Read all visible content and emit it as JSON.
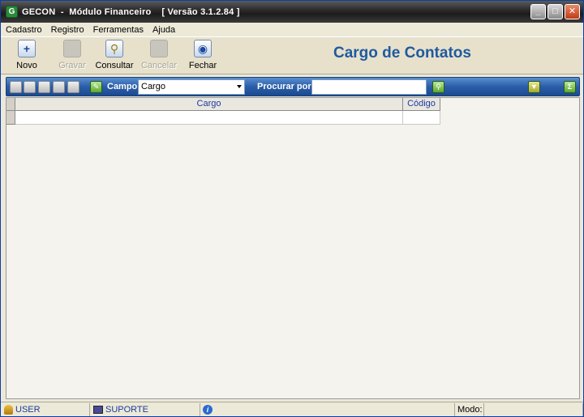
{
  "window": {
    "title": "GECON  -  Módulo Financeiro    [ Versão 3.1.2.84 ]",
    "app_icon_letter": "G"
  },
  "menu": {
    "items": [
      "Cadastro",
      "Registro",
      "Ferramentas",
      "Ajuda"
    ]
  },
  "toolbar": {
    "novo": "Novo",
    "gravar": "Gravar",
    "consultar": "Consultar",
    "cancelar": "Cancelar",
    "fechar": "Fechar"
  },
  "form": {
    "title": "Cargo de Contatos"
  },
  "search": {
    "campo_label": "Campo",
    "campo_value": "Cargo",
    "procurar_label": "Procurar por",
    "procurar_value": ""
  },
  "grid": {
    "columns": [
      "Cargo",
      "Código"
    ]
  },
  "status": {
    "user": "USER",
    "machine": "SUPORTE",
    "modo_label": "Modo:",
    "modo_value": ""
  },
  "colors": {
    "title_accent": "#1f5a9e",
    "searchbar": "#2a5ea8",
    "grid_header_text": "#1c3aa0"
  }
}
